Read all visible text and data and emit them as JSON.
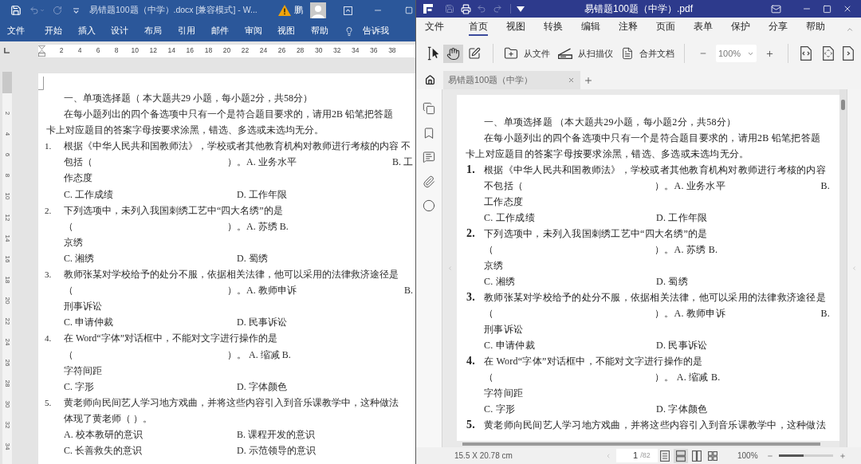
{
  "word_window": {
    "title": "易错题100题（中学）.docx [兼容模式] - W...",
    "user_name": "鹏",
    "ribbon_tabs": [
      "文件",
      "开始",
      "插入",
      "设计",
      "布局",
      "引用",
      "邮件",
      "审阅",
      "视图",
      "帮助"
    ],
    "tell_me": "告诉我",
    "horizontal_ruler": [
      "2",
      "4",
      "6",
      "8",
      "10",
      "12",
      "14",
      "16",
      "18",
      "20",
      "22",
      "24",
      "26",
      "28",
      "30",
      "32",
      "34",
      "36",
      "38"
    ],
    "vertical_ruler": [
      "2",
      "4",
      "6",
      "8",
      "10",
      "12",
      "14",
      "16",
      "18",
      "20",
      "22",
      "24",
      "26",
      "28",
      "30",
      "32",
      "34"
    ],
    "document": [
      {
        "kind": "heading",
        "text": "一、单项选择题（ 本大题共29 小题，每小题2分，共58分）"
      },
      {
        "kind": "text",
        "text": "在每小题列出的四个备选项中只有一个是符合题目要求的，请用2B 铅笔把答题"
      },
      {
        "kind": "flush",
        "text": "卡上对应题目的答案字母按要求涂黑，错选、多选或未选均无分。"
      },
      {
        "kind": "question",
        "number": "1.",
        "text": "根据《中华人民共和国教师法》，学校或者其他教育机构对教师进行考核的内容 不"
      },
      {
        "kind": "answer",
        "text": "包括（",
        "choice": "）。A. 业务水平",
        "tail": "B. 工"
      },
      {
        "kind": "text",
        "text": "作态度"
      },
      {
        "kind": "options",
        "left": "C. 工作成绩",
        "right": "D. 工作年限"
      },
      {
        "kind": "question",
        "number": "2.",
        "text": "下列选项中，未列入我国刺绣工艺中“四大名绣”的是"
      },
      {
        "kind": "answer",
        "text": "（",
        "choice": "）。A. 苏绣 B."
      },
      {
        "kind": "text",
        "text": "京绣"
      },
      {
        "kind": "options",
        "left": "C. 湘绣",
        "right": "D. 蜀绣"
      },
      {
        "kind": "question",
        "number": "3.",
        "text": "教师张某对学校给予的处分不服，依据相关法律，他可以采用的法律救济途径是"
      },
      {
        "kind": "answer",
        "text": "（",
        "choice": "）。A. 教师申诉",
        "tail": "B."
      },
      {
        "kind": "text",
        "text": "刑事诉讼"
      },
      {
        "kind": "options",
        "left": "C. 申请仲裁",
        "right": "D. 民事诉讼"
      },
      {
        "kind": "question",
        "number": "4.",
        "text": "在 Word“字体”对话框中，不能对文字进行操作的是"
      },
      {
        "kind": "answer",
        "text": "（",
        "choice": "）。 A. 缩减 B."
      },
      {
        "kind": "text",
        "text": "字符间距"
      },
      {
        "kind": "options",
        "left": "C. 字形",
        "right": "D. 字体颜色"
      },
      {
        "kind": "question",
        "number": "5.",
        "text": "黄老师向民间艺人学习地方戏曲，并将这些内容引入到音乐课教学中，这种做法"
      },
      {
        "kind": "text",
        "text": "体现了黄老师（ ）。"
      },
      {
        "kind": "options",
        "left": "A. 校本教研的意识",
        "right": "B. 课程开发的意识"
      },
      {
        "kind": "options",
        "left": "C. 长善救失的意识",
        "right": "D. 示范领导的意识"
      }
    ]
  },
  "pdf_window": {
    "title": "易错题100题（中学）.pdf",
    "menu_tabs": [
      {
        "label": "文件",
        "selected": false
      },
      {
        "label": "首页",
        "selected": true
      },
      {
        "label": "视图",
        "selected": false
      },
      {
        "label": "转换",
        "selected": false
      },
      {
        "label": "编辑",
        "selected": false
      },
      {
        "label": "注释",
        "selected": false
      },
      {
        "label": "页面",
        "selected": false
      },
      {
        "label": "表单",
        "selected": false
      },
      {
        "label": "保护",
        "selected": false
      },
      {
        "label": "分享",
        "selected": false
      },
      {
        "label": "帮助",
        "selected": false
      }
    ],
    "tools": [
      {
        "kind": "select",
        "selected": false
      },
      {
        "kind": "hand",
        "selected": true
      },
      {
        "kind": "edit",
        "selected": false
      }
    ],
    "actions": [
      {
        "kind": "folder",
        "label": "从文件"
      },
      {
        "kind": "scanner",
        "label": "从扫描仪"
      },
      {
        "kind": "merge",
        "label": "合并文档"
      }
    ],
    "zoom_field": "100%",
    "document_tabs": [
      {
        "label": "易错题100题（中学）",
        "selected": true
      }
    ],
    "document": [
      {
        "kind": "heading",
        "text": "一、单项选择题 （本大题共29小题，每小题2分，共58分）"
      },
      {
        "kind": "text",
        "text": "在每小题列出的四个备选项中只有一个是符合题目要求的，请用2B 铅笔把答题"
      },
      {
        "kind": "flush",
        "text": "卡上对应题目的答案字母按要求涂黑，错选、多选或未选均无分。"
      },
      {
        "kind": "question",
        "number": "1.",
        "text": "根据《中华人民共和国教师法》，学校或者其他教育机构对教师进行考核的内容"
      },
      {
        "kind": "answer",
        "text": "不包括（",
        "choice": "）。A. 业务水平",
        "tail": "B."
      },
      {
        "kind": "text",
        "text": "工作态度"
      },
      {
        "kind": "options",
        "left": "C. 工作成绩",
        "right": "D. 工作年限"
      },
      {
        "kind": "question",
        "number": "2.",
        "text": "下列选项中，未列入我国刺绣工艺中“四大名绣”的是"
      },
      {
        "kind": "answer",
        "text": "（",
        "choice": "）。A. 苏绣 B."
      },
      {
        "kind": "text",
        "text": "京绣"
      },
      {
        "kind": "options",
        "left": "C. 湘绣",
        "right": "D. 蜀绣"
      },
      {
        "kind": "question",
        "number": "3.",
        "text": "教师张某对学校给予的处分不服，依据相关法律，他可以采用的法律救济途径是"
      },
      {
        "kind": "answer",
        "text": "（",
        "choice": "）。A. 教师申诉",
        "tail": "B."
      },
      {
        "kind": "text",
        "text": "刑事诉讼"
      },
      {
        "kind": "options",
        "left": "C. 申请仲裁",
        "right": "D. 民事诉讼"
      },
      {
        "kind": "question",
        "number": "4.",
        "text": "在 Word“字体”对话框中，不能对文字进行操作的是"
      },
      {
        "kind": "answer",
        "text": "（",
        "choice": "）。 A. 缩减 B."
      },
      {
        "kind": "text",
        "text": "字符间距"
      },
      {
        "kind": "options",
        "left": "C. 字形",
        "right": "D. 字体颜色"
      },
      {
        "kind": "question",
        "number": "5.",
        "text": "黄老师向民间艺人学习地方戏曲，并将这些内容引入到音乐课教学中，这种做法"
      }
    ],
    "status_bar": {
      "page_size": "15.5 X 20.78 cm",
      "page": "1",
      "page_total": "/82",
      "views": [
        {
          "kind": "single",
          "selected": false
        },
        {
          "kind": "continuous",
          "selected": true
        },
        {
          "kind": "two_page",
          "selected": false
        },
        {
          "kind": "grid",
          "selected": false
        }
      ],
      "zoom": "100%",
      "zoom_slider": {
        "level": 0.46
      }
    }
  }
}
